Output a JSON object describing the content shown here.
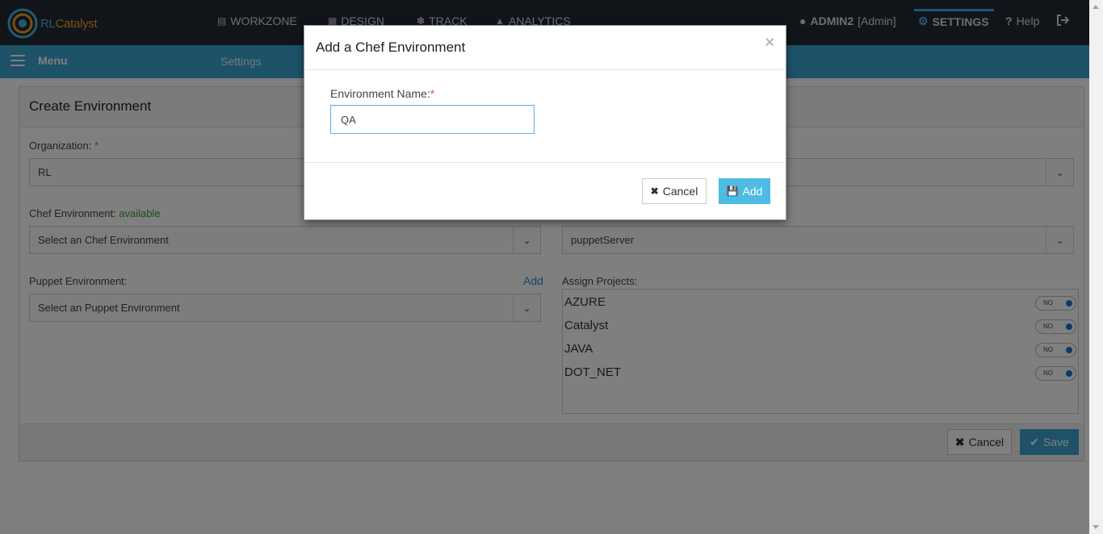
{
  "brand": {
    "prefix": "RL",
    "name": "Catalyst"
  },
  "nav": {
    "items": [
      {
        "label": "WORKZONE",
        "icon": "card-icon"
      },
      {
        "label": "DESIGN",
        "icon": "sitemap-icon"
      },
      {
        "label": "TRACK",
        "icon": "pin-icon"
      },
      {
        "label": "ANALYTICS",
        "icon": "area-chart-icon"
      }
    ],
    "user": {
      "name": "ADMIN2",
      "role": "[Admin]"
    },
    "settings": "SETTINGS",
    "help": "Help"
  },
  "subbar": {
    "menu": "Menu",
    "crumb": "Settings"
  },
  "panel": {
    "title": "Create Environment",
    "organization": {
      "label": "Organization:",
      "required": "*",
      "value": "RL"
    },
    "chef": {
      "label": "Chef Environment:",
      "status": "available",
      "placeholder": "Select an Chef Environment"
    },
    "puppet": {
      "label": "Puppet Environment:",
      "add": "Add",
      "placeholder": "Select an Puppet Environment"
    },
    "puppet_server": {
      "value": "puppetServer"
    },
    "projects": {
      "label": "Assign Projects:",
      "items": [
        {
          "name": "AZURE",
          "state": "NO"
        },
        {
          "name": "Catalyst",
          "state": "NO"
        },
        {
          "name": "JAVA",
          "state": "NO"
        },
        {
          "name": "DOT_NET",
          "state": "NO"
        }
      ]
    },
    "cancel": "Cancel",
    "save": "Save"
  },
  "modal": {
    "title": "Add a Chef Environment",
    "close": "×",
    "field_label": "Environment Name:",
    "required": "*",
    "value": "QA",
    "cancel": "Cancel",
    "add": "Add"
  }
}
